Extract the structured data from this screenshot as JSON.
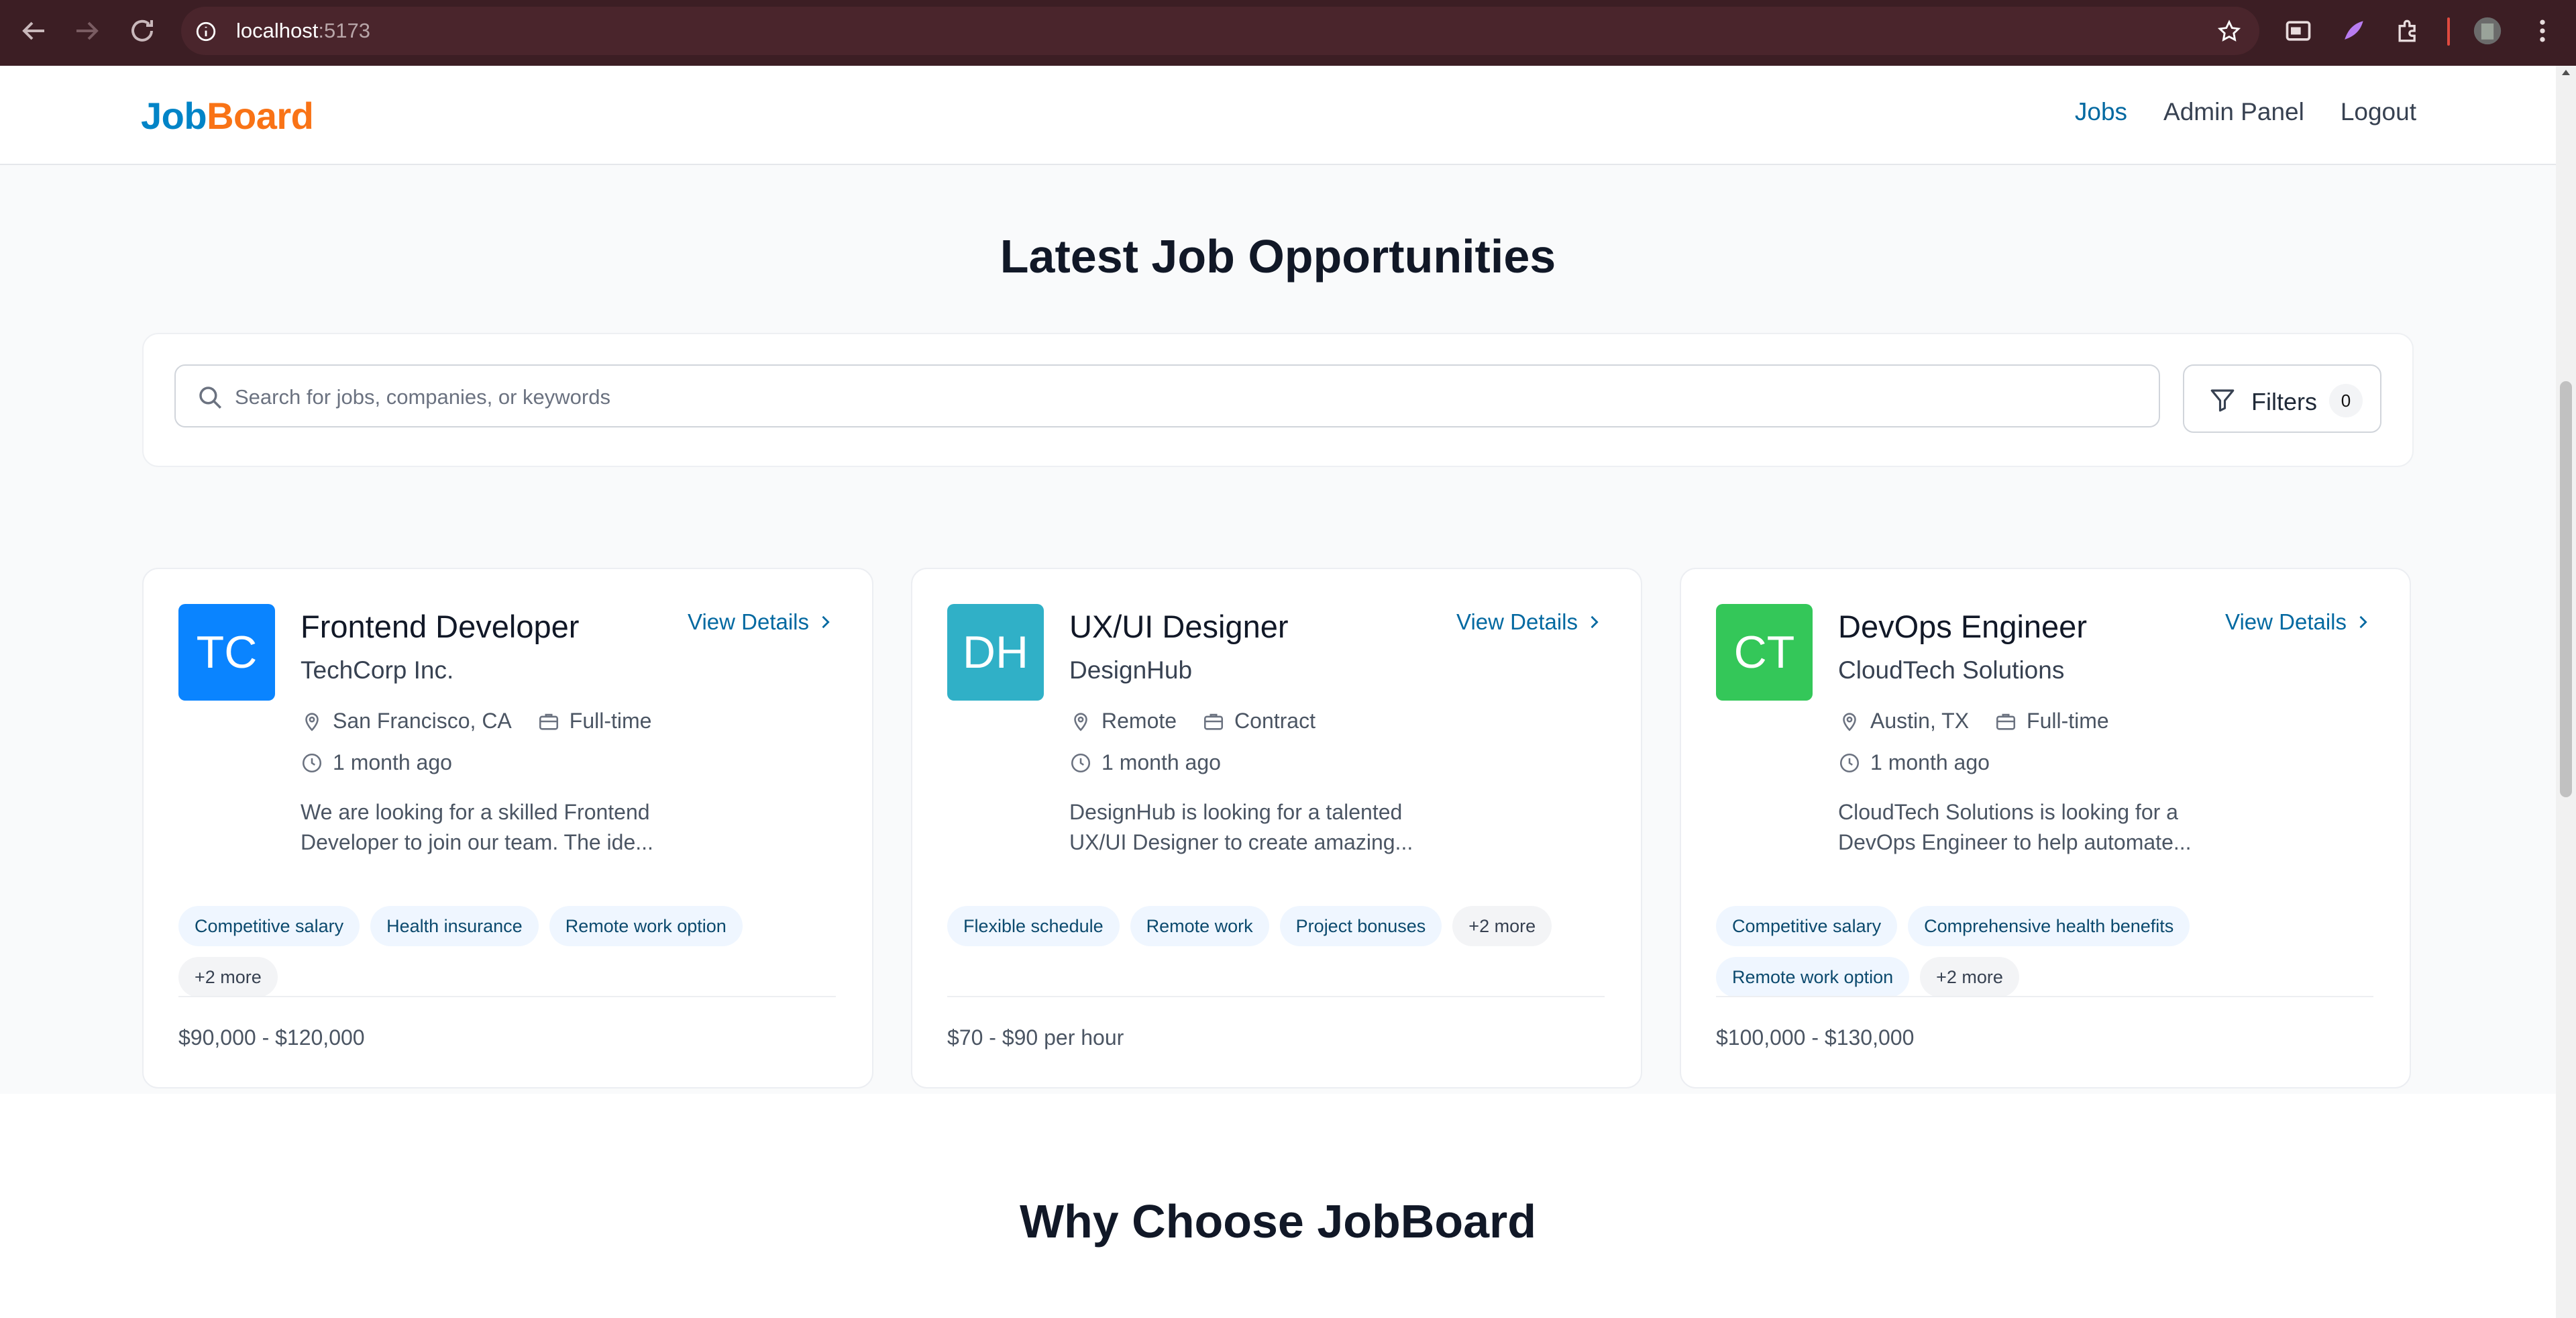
{
  "browser": {
    "url_host": "localhost",
    "url_port": ":5173"
  },
  "nav": {
    "logo_part1": "Job",
    "logo_part2": "Board",
    "links": [
      "Jobs",
      "Admin Panel",
      "Logout"
    ]
  },
  "hero": {
    "title": "Latest Job Opportunities"
  },
  "search": {
    "placeholder": "Search for jobs, companies, or keywords",
    "filters_label": "Filters",
    "filters_count": "0"
  },
  "jobs": [
    {
      "initials": "TC",
      "color": "#0a84ff",
      "title": "Frontend Developer",
      "company": "TechCorp Inc.",
      "view_details": "View Details",
      "location": "San Francisco, CA",
      "type": "Full-time",
      "posted": "1 month ago",
      "description": "We are looking for a skilled Frontend Developer to join our team. The ide...",
      "tags": [
        "Competitive salary",
        "Health insurance",
        "Remote work option"
      ],
      "more": "+2 more",
      "salary": "$90,000 - $120,000"
    },
    {
      "initials": "DH",
      "color": "#30b0c7",
      "title": "UX/UI Designer",
      "company": "DesignHub",
      "view_details": "View Details",
      "location": "Remote",
      "type": "Contract",
      "posted": "1 month ago",
      "description": "DesignHub is looking for a talented UX/UI Designer to create amazing...",
      "tags": [
        "Flexible schedule",
        "Remote work",
        "Project bonuses"
      ],
      "more": "+2 more",
      "salary": "$70 - $90 per hour"
    },
    {
      "initials": "CT",
      "color": "#34c759",
      "title": "DevOps Engineer",
      "company": "CloudTech Solutions",
      "view_details": "View Details",
      "location": "Austin, TX",
      "type": "Full-time",
      "posted": "1 month ago",
      "description": "CloudTech Solutions is looking for a DevOps Engineer to help automate...",
      "tags": [
        "Competitive salary",
        "Comprehensive health benefits",
        "Remote work option"
      ],
      "more": "+2 more",
      "salary": "$100,000 - $130,000"
    }
  ],
  "section2": {
    "title": "Why Choose JobBoard"
  }
}
